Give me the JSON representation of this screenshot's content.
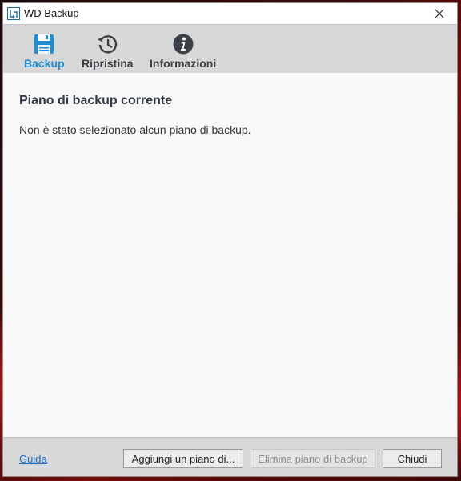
{
  "window": {
    "title": "WD Backup"
  },
  "toolbar": {
    "items": [
      {
        "label": "Backup",
        "icon": "floppy-disk-icon",
        "active": true
      },
      {
        "label": "Ripristina",
        "icon": "history-icon",
        "active": false
      },
      {
        "label": "Informazioni",
        "icon": "info-icon",
        "active": false
      }
    ]
  },
  "main": {
    "title": "Piano di backup corrente",
    "message": "Non è stato selezionato alcun piano di backup."
  },
  "footer": {
    "help_label": "Guida",
    "add_label": "Aggiungi un piano di...",
    "delete_label": "Elimina piano di backup",
    "close_label": "Chiudi"
  },
  "colors": {
    "accent": "#1e8fd6",
    "nav_text": "#3c4148",
    "link": "#1e6fc0"
  }
}
